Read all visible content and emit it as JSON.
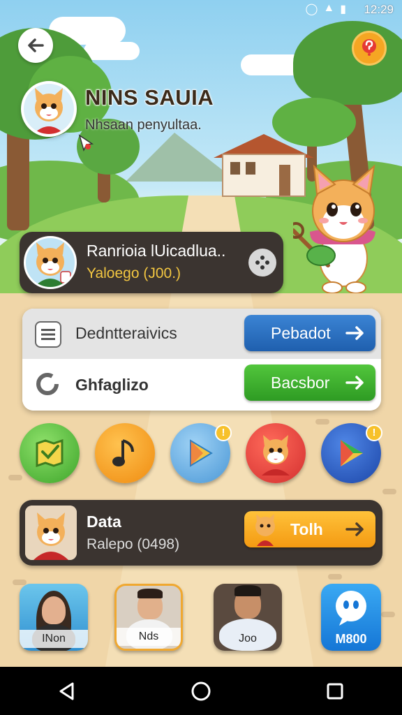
{
  "status_bar": {
    "time": "12:29"
  },
  "header": {
    "title": "NINS SAUIA",
    "subtitle": "Nhsaan penyultaa."
  },
  "profile_card": {
    "name": "Ranrioia lUicadlua..",
    "detail": "Yaloego (J00.)"
  },
  "menu": {
    "row1": {
      "label": "Dedntteraivics",
      "button": "Pebadot"
    },
    "row2": {
      "label": "Ghfaglizo",
      "button": "Bacsbor"
    }
  },
  "apps": [
    {
      "name": "map",
      "color": "#59c23a",
      "badge": ""
    },
    {
      "name": "music",
      "color": "#f6a21e",
      "badge": ""
    },
    {
      "name": "play",
      "color": "#5aa9e4",
      "badge": "!"
    },
    {
      "name": "cat",
      "color": "#e53935",
      "badge": ""
    },
    {
      "name": "play-store",
      "color": "#2a5fc7",
      "badge": "!"
    }
  ],
  "data_card": {
    "title": "Data",
    "detail": "Ralepo (0498)",
    "button": "Tolh"
  },
  "tiles": [
    {
      "label": "INon"
    },
    {
      "label": "Nds"
    },
    {
      "label": "Joo"
    },
    {
      "label": "M800"
    }
  ],
  "colors": {
    "accent_blue": "#1f5fae",
    "accent_green": "#2e9b23",
    "accent_orange": "#f49a12",
    "card_dark": "#3b3430",
    "highlight_yellow": "#f2c641"
  }
}
